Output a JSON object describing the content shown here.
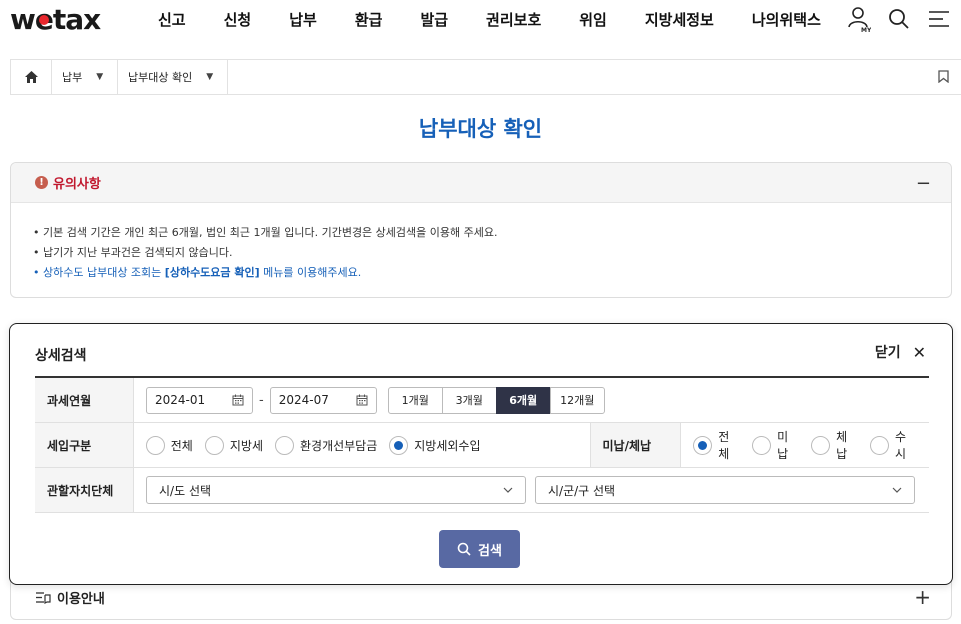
{
  "header": {
    "logo": "wetax",
    "nav": [
      "신고",
      "신청",
      "납부",
      "환급",
      "발급",
      "권리보호",
      "위임",
      "지방세정보",
      "나의위택스"
    ],
    "icons": [
      "user-my-icon",
      "search-icon",
      "menu-icon"
    ],
    "my_label": "MY"
  },
  "breadcrumb": {
    "level1": "납부",
    "level2": "납부대상 확인"
  },
  "page": {
    "title": "납부대상 확인"
  },
  "notice": {
    "title": "유의사항",
    "toggle": "−",
    "lines": [
      "• 기본 검색 기간은 개인 최근 6개월, 법인 최근 1개월 입니다. 기간변경은 상세검색을 이용해 주세요.",
      "• 납기가 지난 부과건은 검색되지 않습니다."
    ],
    "line3_prefix": "• 상하수도 납부대상 조회는 ",
    "line3_bold": "[상하수도요금 확인]",
    "line3_suffix": " 메뉴를 이용해주세요."
  },
  "search_modal": {
    "title": "상세검색",
    "close_label": "닫기",
    "rows": {
      "period_label": "과세연월",
      "from_date": "2024-01",
      "to_date": "2024-07",
      "date_separator": "-",
      "periods": [
        "1개월",
        "3개월",
        "6개월",
        "12개월"
      ],
      "selected_period": "6개월",
      "income_label": "세입구분",
      "income_options": [
        "전체",
        "지방세",
        "환경개선부담금",
        "지방세외수입"
      ],
      "selected_income": "지방세외수입",
      "status_label": "미납/체납",
      "status_options": [
        "전체",
        "미납",
        "체납",
        "수시"
      ],
      "selected_status": "전체",
      "region_label": "관할자치단체",
      "sido_placeholder": "시/도 선택",
      "sigungu_placeholder": "시/군/구 선택"
    },
    "search_button": "검색"
  },
  "info": {
    "title": "이용안내",
    "toggle": "+"
  },
  "colors": {
    "brand_blue": "#1660b8",
    "notice_red": "#c1182e",
    "selected_period_bg": "#2f3347",
    "search_button_bg": "#5869a3"
  }
}
